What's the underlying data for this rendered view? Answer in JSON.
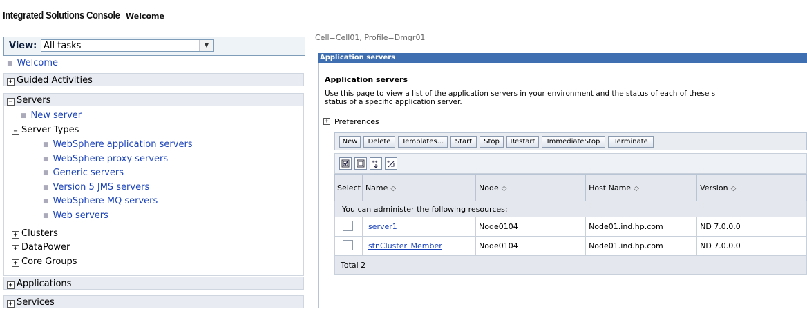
{
  "banner": {
    "app_title": "Integrated Solutions Console",
    "welcome": "Welcome"
  },
  "nav": {
    "view_label": "View:",
    "view_value": "All tasks",
    "welcome_link": "Welcome",
    "sections": {
      "guided": "Guided Activities",
      "servers": "Servers",
      "applications": "Applications",
      "services": "Services"
    },
    "new_server": "New server",
    "server_types_label": "Server Types",
    "server_types": [
      "WebSphere application servers",
      "WebSphere proxy servers",
      "Generic servers",
      "Version 5 JMS servers",
      "WebSphere MQ servers",
      "Web servers"
    ],
    "collapsed": [
      "Clusters",
      "DataPower",
      "Core Groups"
    ]
  },
  "main": {
    "cell_info": "Cell=Cell01, Profile=Dmgr01",
    "titlebar": "Application servers",
    "heading": "Application servers",
    "description_line1": "Use this page to view a list of the application servers in your environment and the status of each of these s",
    "description_line2": "status of a specific application server.",
    "preferences": "Preferences",
    "buttons": [
      "New",
      "Delete",
      "Templates...",
      "Start",
      "Stop",
      "Restart",
      "ImmediateStop",
      "Terminate"
    ],
    "table": {
      "headers": [
        "Select",
        "Name",
        "Node",
        "Host Name",
        "Version"
      ],
      "group_label": "You can administer the following resources:",
      "rows": [
        {
          "name": "server1",
          "node": "Node0104",
          "host": "Node01.ind.hp.com",
          "version": "ND 7.0.0.0"
        },
        {
          "name": "stnCluster_Member",
          "node": "Node0104",
          "host": "Node01.ind.hp.com",
          "version": "ND 7.0.0.0"
        }
      ],
      "total": "Total 2"
    }
  },
  "icons": {
    "expand": "expand-plus-icon",
    "collapse": "collapse-minus-icon",
    "sort": "sort-arrows-icon",
    "select_all": "select-all-icon",
    "deselect_all": "deselect-all-icon",
    "show_filter": "show-filter-icon",
    "clear_filter": "clear-filter-icon"
  },
  "colors": {
    "titlebar": "#3f6fb0",
    "link": "#1b43b9",
    "nav_section_bg": "#e8ecf2"
  }
}
